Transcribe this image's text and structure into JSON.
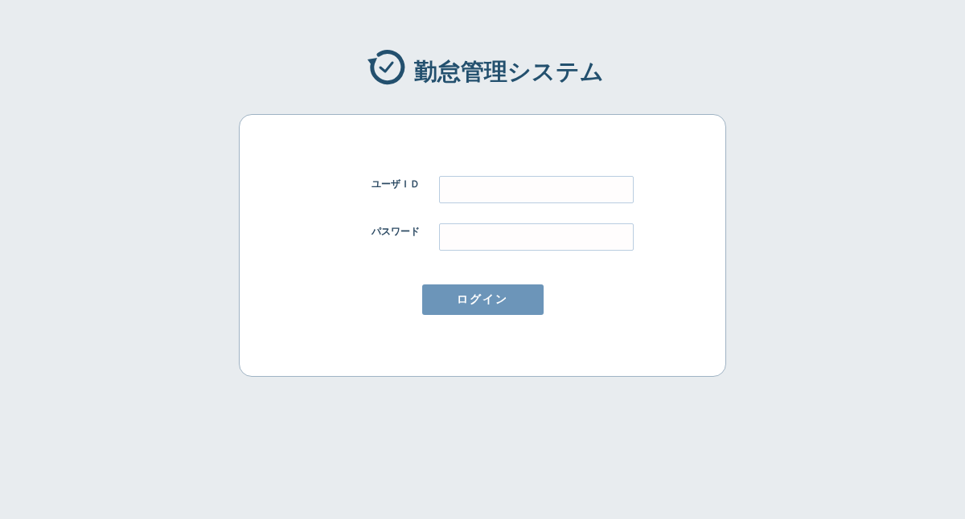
{
  "header": {
    "title": "勤怠管理システム"
  },
  "form": {
    "fields": [
      {
        "label": "ユーザＩＤ"
      },
      {
        "label": "パスワード"
      }
    ],
    "submit": "ログイン"
  }
}
